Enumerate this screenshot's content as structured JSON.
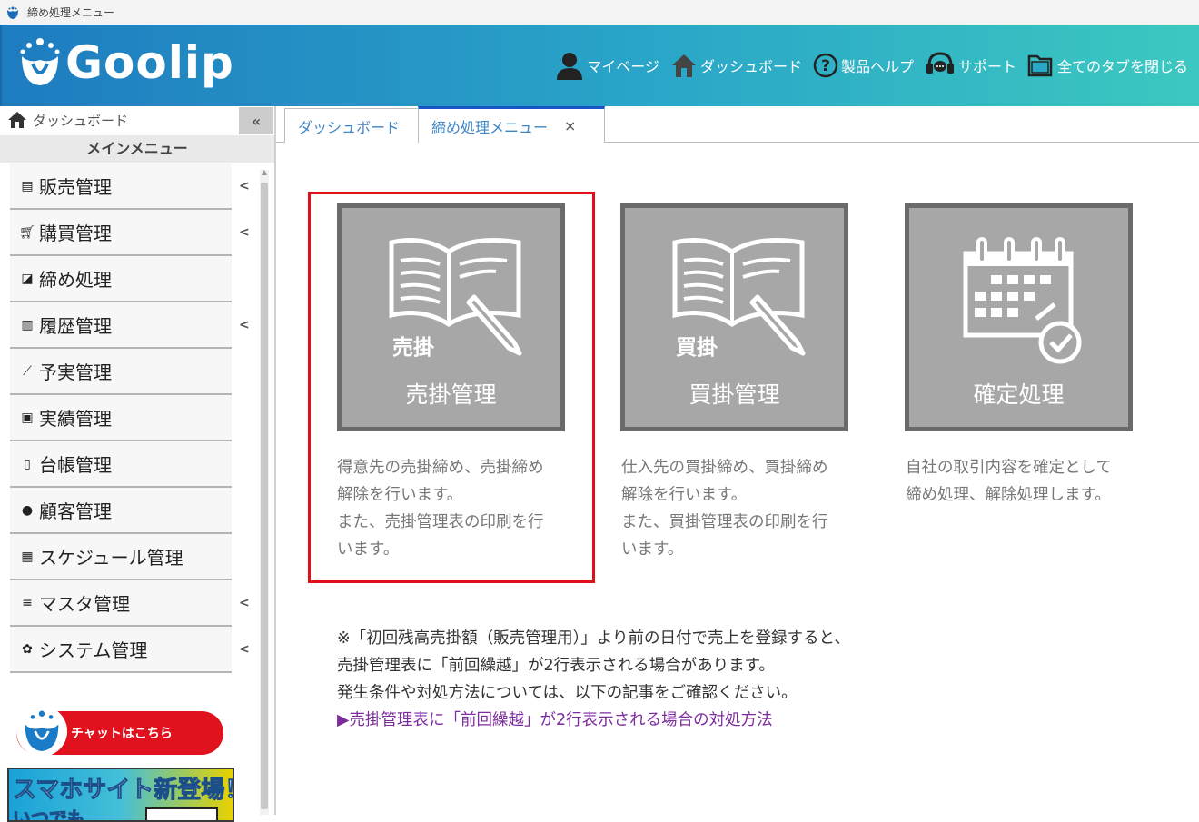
{
  "window": {
    "title": "締め処理メニュー"
  },
  "header": {
    "logo": "Goolip",
    "nav": [
      {
        "label": "マイページ",
        "icon": "user-icon"
      },
      {
        "label": "ダッシュボード",
        "icon": "home-icon"
      },
      {
        "label": "製品ヘルプ",
        "icon": "help-icon"
      },
      {
        "label": "サポート",
        "icon": "headset-icon"
      },
      {
        "label": "全てのタブを閉じる",
        "icon": "folder-icon"
      }
    ]
  },
  "sidebar": {
    "dashboard": "ダッシュボード",
    "collapse": "«",
    "main_menu": "メインメニュー",
    "items": [
      {
        "label": "販売管理",
        "icon": "store-icon",
        "has_chevron": true
      },
      {
        "label": "購買管理",
        "icon": "cart-icon",
        "has_chevron": true
      },
      {
        "label": "締め処理",
        "icon": "edit-icon",
        "has_chevron": false
      },
      {
        "label": "履歴管理",
        "icon": "book-icon",
        "has_chevron": true
      },
      {
        "label": "予実管理",
        "icon": "chart-icon",
        "has_chevron": false
      },
      {
        "label": "実績管理",
        "icon": "bookmark-icon",
        "has_chevron": false
      },
      {
        "label": "台帳管理",
        "icon": "open-book-icon",
        "has_chevron": false
      },
      {
        "label": "顧客管理",
        "icon": "users-icon",
        "has_chevron": false
      },
      {
        "label": "スケジュール管理",
        "icon": "calendar-icon",
        "has_chevron": false
      },
      {
        "label": "マスタ管理",
        "icon": "database-icon",
        "has_chevron": true
      },
      {
        "label": "システム管理",
        "icon": "gear-icon",
        "has_chevron": true
      }
    ],
    "chat_button": "チャットはこちら",
    "banner_line1": "スマホサイト新登場！",
    "banner_line2": "いつでも"
  },
  "tabs": [
    {
      "label": "ダッシュボード"
    },
    {
      "label": "締め処理メニュー",
      "close": "×"
    }
  ],
  "cards": [
    {
      "tag": "売掛",
      "label": "売掛管理",
      "desc": [
        "得意先の売掛締め、売掛締め",
        "解除を行います。",
        "また、売掛管理表の印刷を行",
        "います。"
      ]
    },
    {
      "tag": "買掛",
      "label": "買掛管理",
      "desc": [
        "仕入先の買掛締め、買掛締め",
        "解除を行います。",
        "また、買掛管理表の印刷を行",
        "います。"
      ]
    },
    {
      "tag": "",
      "label": "確定処理",
      "desc": [
        "自社の取引内容を確定として",
        "締め処理、解除処理します。"
      ]
    }
  ],
  "note": {
    "lines": [
      "※「初回残高売掛額（販売管理用）」より前の日付で売上を登録すると、",
      "売掛管理表に「前回繰越」が2行表示される場合があります。",
      "発生条件や対処方法については、以下の記事をご確認ください。"
    ],
    "link": "▶売掛管理表に「前回繰越」が2行表示される場合の対処方法"
  },
  "colors": {
    "highlight": "#e0101a",
    "card_bg": "#a7a7a7",
    "link": "#7c2c9e",
    "tab_active": "#1a55c7"
  }
}
